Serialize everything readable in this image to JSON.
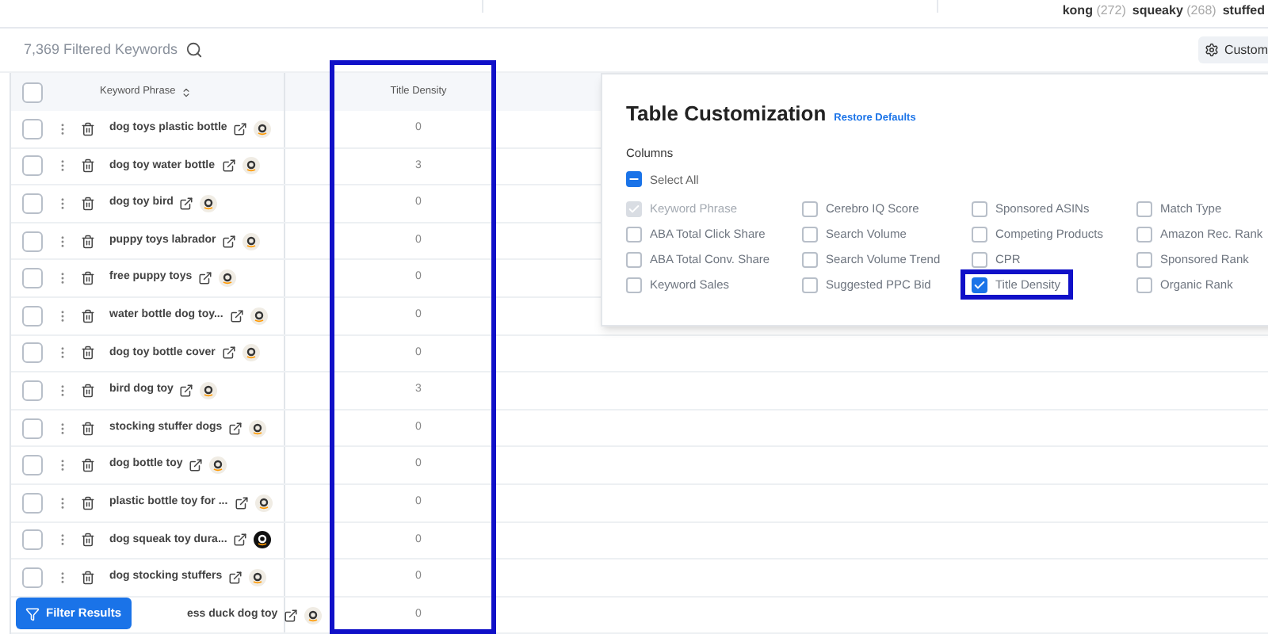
{
  "top_tags": [
    {
      "word": "kong",
      "count": "(272)"
    },
    {
      "word": "squeaky",
      "count": "(268)"
    },
    {
      "word": "stuffed"
    }
  ],
  "toolbar": {
    "count_label": "7,369 Filtered Keywords",
    "customize_button": "Custom"
  },
  "table": {
    "columns": [
      "Keyword Phrase",
      "Title Density"
    ],
    "select_all_checked": false,
    "rows": [
      {
        "keyword": "dog toys plastic bottle",
        "title_density": "0",
        "checked": false,
        "badge_dark": false,
        "covered": false
      },
      {
        "keyword": "dog toy water bottle",
        "title_density": "3",
        "checked": false,
        "badge_dark": false,
        "covered": false
      },
      {
        "keyword": "dog toy bird",
        "title_density": "0",
        "checked": false,
        "badge_dark": false,
        "covered": false
      },
      {
        "keyword": "puppy toys labrador",
        "title_density": "0",
        "checked": false,
        "badge_dark": false,
        "covered": false
      },
      {
        "keyword": "free puppy toys",
        "title_density": "0",
        "checked": false,
        "badge_dark": false,
        "covered": false
      },
      {
        "keyword": "water bottle dog toy...",
        "title_density": "0",
        "checked": false,
        "badge_dark": false,
        "covered": false
      },
      {
        "keyword": "dog toy bottle cover",
        "title_density": "0",
        "checked": false,
        "badge_dark": false,
        "covered": false
      },
      {
        "keyword": "bird dog toy",
        "title_density": "3",
        "checked": false,
        "badge_dark": false,
        "covered": false
      },
      {
        "keyword": "stocking stuffer dogs",
        "title_density": "0",
        "checked": false,
        "badge_dark": false,
        "covered": false
      },
      {
        "keyword": "dog bottle toy",
        "title_density": "0",
        "checked": false,
        "badge_dark": false,
        "covered": false
      },
      {
        "keyword": "plastic bottle toy for ...",
        "title_density": "0",
        "checked": false,
        "badge_dark": false,
        "covered": false
      },
      {
        "keyword": "dog squeak toy dura...",
        "title_density": "0",
        "checked": false,
        "badge_dark": true,
        "covered": false
      },
      {
        "keyword": "dog stocking stuffers",
        "title_density": "0",
        "checked": false,
        "badge_dark": false,
        "covered": false
      },
      {
        "keyword": "ess duck dog toy",
        "title_density": "0",
        "badge_dark": false,
        "covered": true
      }
    ]
  },
  "customization_panel": {
    "title": "Table Customization",
    "restore_link": "Restore Defaults",
    "section_label": "Columns",
    "select_all": {
      "label": "Select All",
      "indeterminate": true
    },
    "options": [
      {
        "label": "Keyword Phrase",
        "checked": true,
        "disabled": true,
        "highlighted": false
      },
      {
        "label": "Cerebro IQ Score",
        "checked": false,
        "disabled": false,
        "highlighted": false
      },
      {
        "label": "Sponsored ASINs",
        "checked": false,
        "disabled": false,
        "highlighted": false
      },
      {
        "label": "Match Type",
        "checked": false,
        "disabled": false,
        "highlighted": false
      },
      {
        "label": "ABA Total Click Share",
        "checked": false,
        "disabled": false,
        "highlighted": false
      },
      {
        "label": "Search Volume",
        "checked": false,
        "disabled": false,
        "highlighted": false
      },
      {
        "label": "Competing Products",
        "checked": false,
        "disabled": false,
        "highlighted": false
      },
      {
        "label": "Amazon Rec. Rank",
        "checked": false,
        "disabled": false,
        "highlighted": false
      },
      {
        "label": "ABA Total Conv. Share",
        "checked": false,
        "disabled": false,
        "highlighted": false
      },
      {
        "label": "Search Volume Trend",
        "checked": false,
        "disabled": false,
        "highlighted": false
      },
      {
        "label": "CPR",
        "checked": false,
        "disabled": false,
        "highlighted": false
      },
      {
        "label": "Sponsored Rank",
        "checked": false,
        "disabled": false,
        "highlighted": false
      },
      {
        "label": "Keyword Sales",
        "checked": false,
        "disabled": false,
        "highlighted": false
      },
      {
        "label": "Suggested PPC Bid",
        "checked": false,
        "disabled": false,
        "highlighted": false
      },
      {
        "label": "Title Density",
        "checked": true,
        "disabled": false,
        "highlighted": true
      },
      {
        "label": "Organic Rank",
        "checked": false,
        "disabled": false,
        "highlighted": false
      }
    ]
  },
  "filter_button": "Filter Results",
  "column_highlight": true
}
